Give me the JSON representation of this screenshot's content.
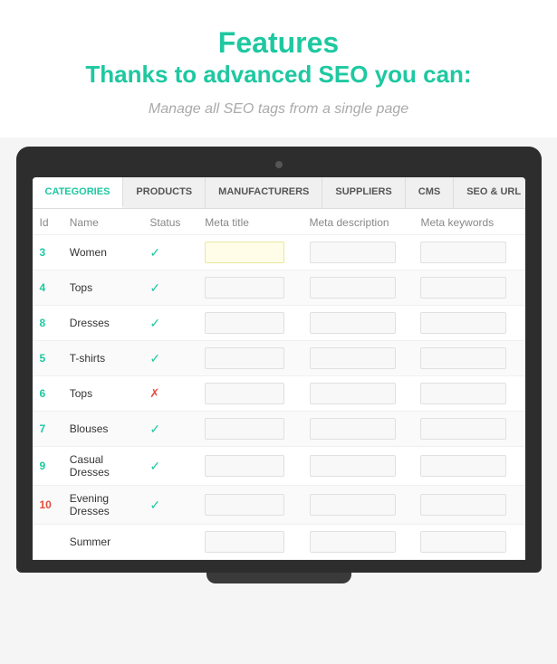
{
  "header": {
    "title": "Features",
    "subtitle": "Thanks to advanced SEO you can:",
    "description": "Manage all SEO tags from a single page"
  },
  "tabs": [
    {
      "id": "categories",
      "label": "CATEGORIES",
      "active": true
    },
    {
      "id": "products",
      "label": "PRODUCTS",
      "active": false
    },
    {
      "id": "manufacturers",
      "label": "MANUFACTURERS",
      "active": false
    },
    {
      "id": "suppliers",
      "label": "SUPPLIERS",
      "active": false
    },
    {
      "id": "cms",
      "label": "CMS",
      "active": false
    },
    {
      "id": "seo-url",
      "label": "SEO & URL",
      "active": false
    }
  ],
  "table": {
    "columns": [
      {
        "id": "id",
        "label": "Id"
      },
      {
        "id": "name",
        "label": "Name"
      },
      {
        "id": "status",
        "label": "Status"
      },
      {
        "id": "meta_title",
        "label": "Meta title"
      },
      {
        "id": "meta_description",
        "label": "Meta description"
      },
      {
        "id": "meta_keywords",
        "label": "Meta keywords"
      }
    ],
    "rows": [
      {
        "id": "3",
        "name": "Women",
        "status": "check",
        "meta_title": "",
        "meta_description": "",
        "meta_keywords": "",
        "focused": true
      },
      {
        "id": "4",
        "name": "Tops",
        "status": "check",
        "meta_title": "",
        "meta_description": "",
        "meta_keywords": "",
        "focused": false
      },
      {
        "id": "8",
        "name": "Dresses",
        "status": "check",
        "meta_title": "",
        "meta_description": "",
        "meta_keywords": "",
        "focused": false
      },
      {
        "id": "5",
        "name": "T-shirts",
        "status": "check",
        "meta_title": "",
        "meta_description": "",
        "meta_keywords": "",
        "focused": false
      },
      {
        "id": "6",
        "name": "Tops",
        "status": "cross",
        "meta_title": "",
        "meta_description": "",
        "meta_keywords": "",
        "focused": false
      },
      {
        "id": "7",
        "name": "Blouses",
        "status": "check",
        "meta_title": "",
        "meta_description": "",
        "meta_keywords": "",
        "focused": false
      },
      {
        "id": "9",
        "name": "Casual Dresses",
        "status": "check",
        "meta_title": "",
        "meta_description": "",
        "meta_keywords": "",
        "focused": false
      },
      {
        "id": "10",
        "name": "Evening Dresses",
        "status": "check",
        "meta_title": "",
        "meta_description": "",
        "meta_keywords": "",
        "focused": false
      },
      {
        "id": "",
        "name": "Summer",
        "status": "",
        "meta_title": "",
        "meta_description": "",
        "meta_keywords": "",
        "focused": false
      }
    ]
  },
  "colors": {
    "accent": "#1ec8a0",
    "error": "#e74c3c"
  }
}
